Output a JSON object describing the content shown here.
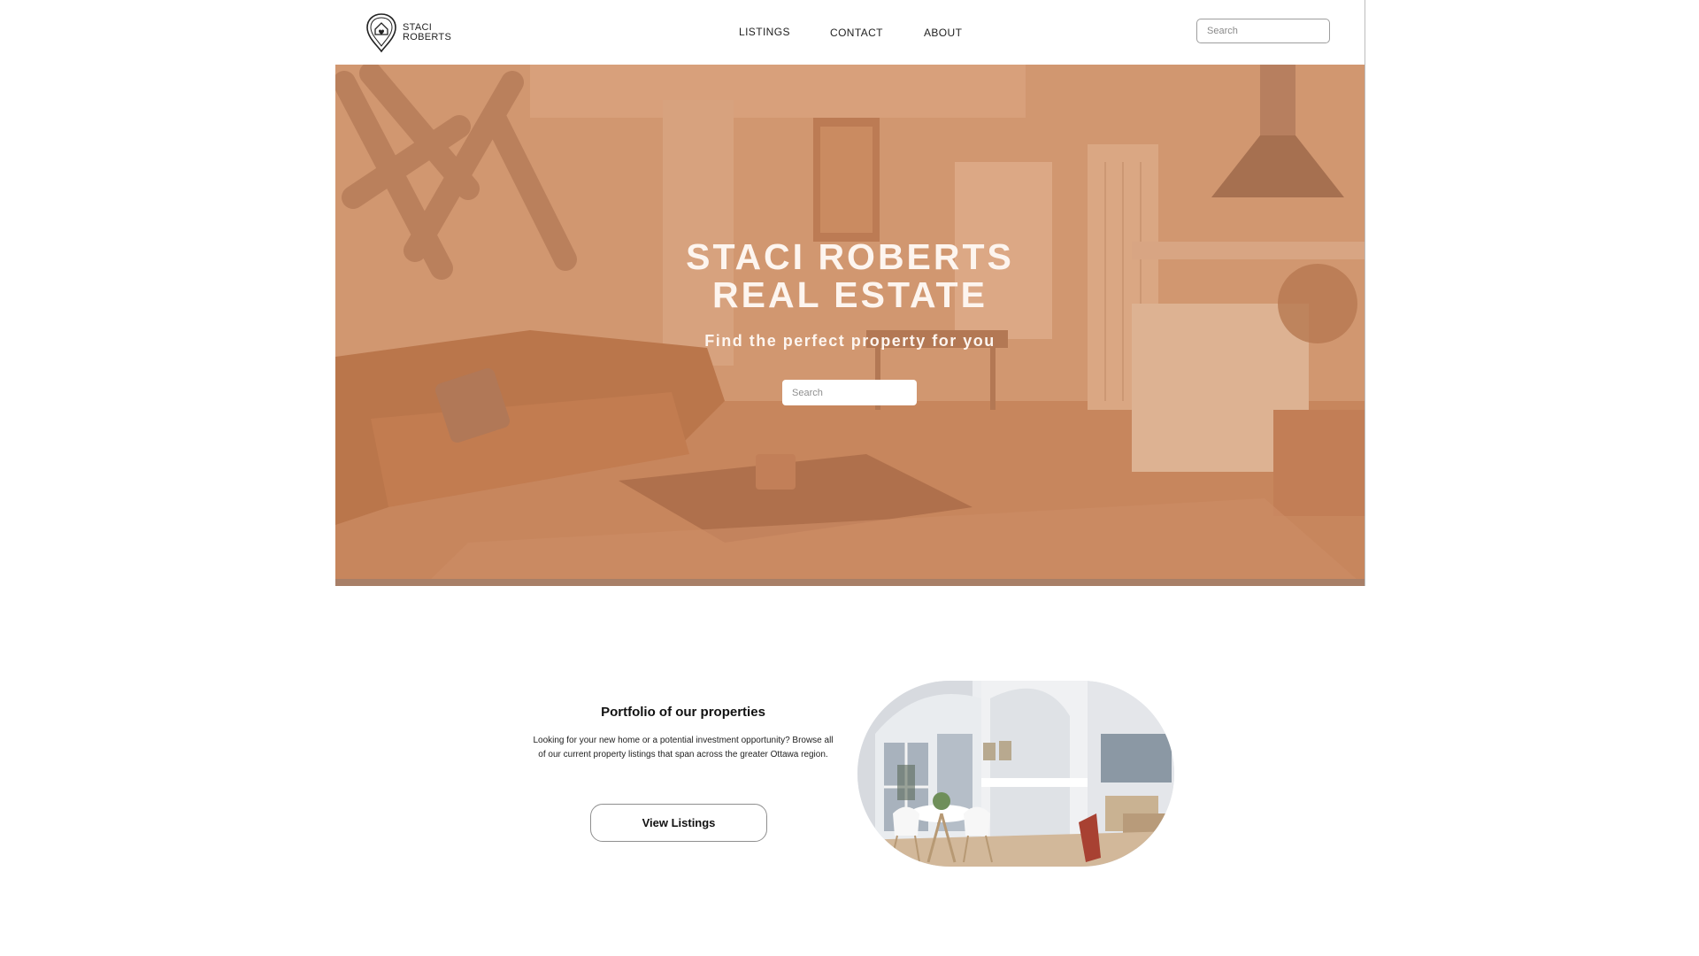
{
  "header": {
    "brand_line1": "STACI",
    "brand_line2": "ROBERTS",
    "logo_icon": "map-pin-house-icon",
    "nav": [
      {
        "label": "LISTINGS"
      },
      {
        "label": "CONTACT"
      },
      {
        "label": "ABOUT"
      }
    ],
    "search_placeholder": "Search"
  },
  "hero": {
    "title_line1": "STACI ROBERTS",
    "title_line2": "REAL ESTATE",
    "subtitle": "Find the perfect property for you",
    "search_placeholder": "Search",
    "tint_color": "#c68c66"
  },
  "portfolio": {
    "title": "Portfolio of our properties",
    "description": "Looking for your new home or a potential investment opportunity? Browse all of our current property listings that span across the greater Ottawa region.",
    "button_label": "View Listings"
  }
}
